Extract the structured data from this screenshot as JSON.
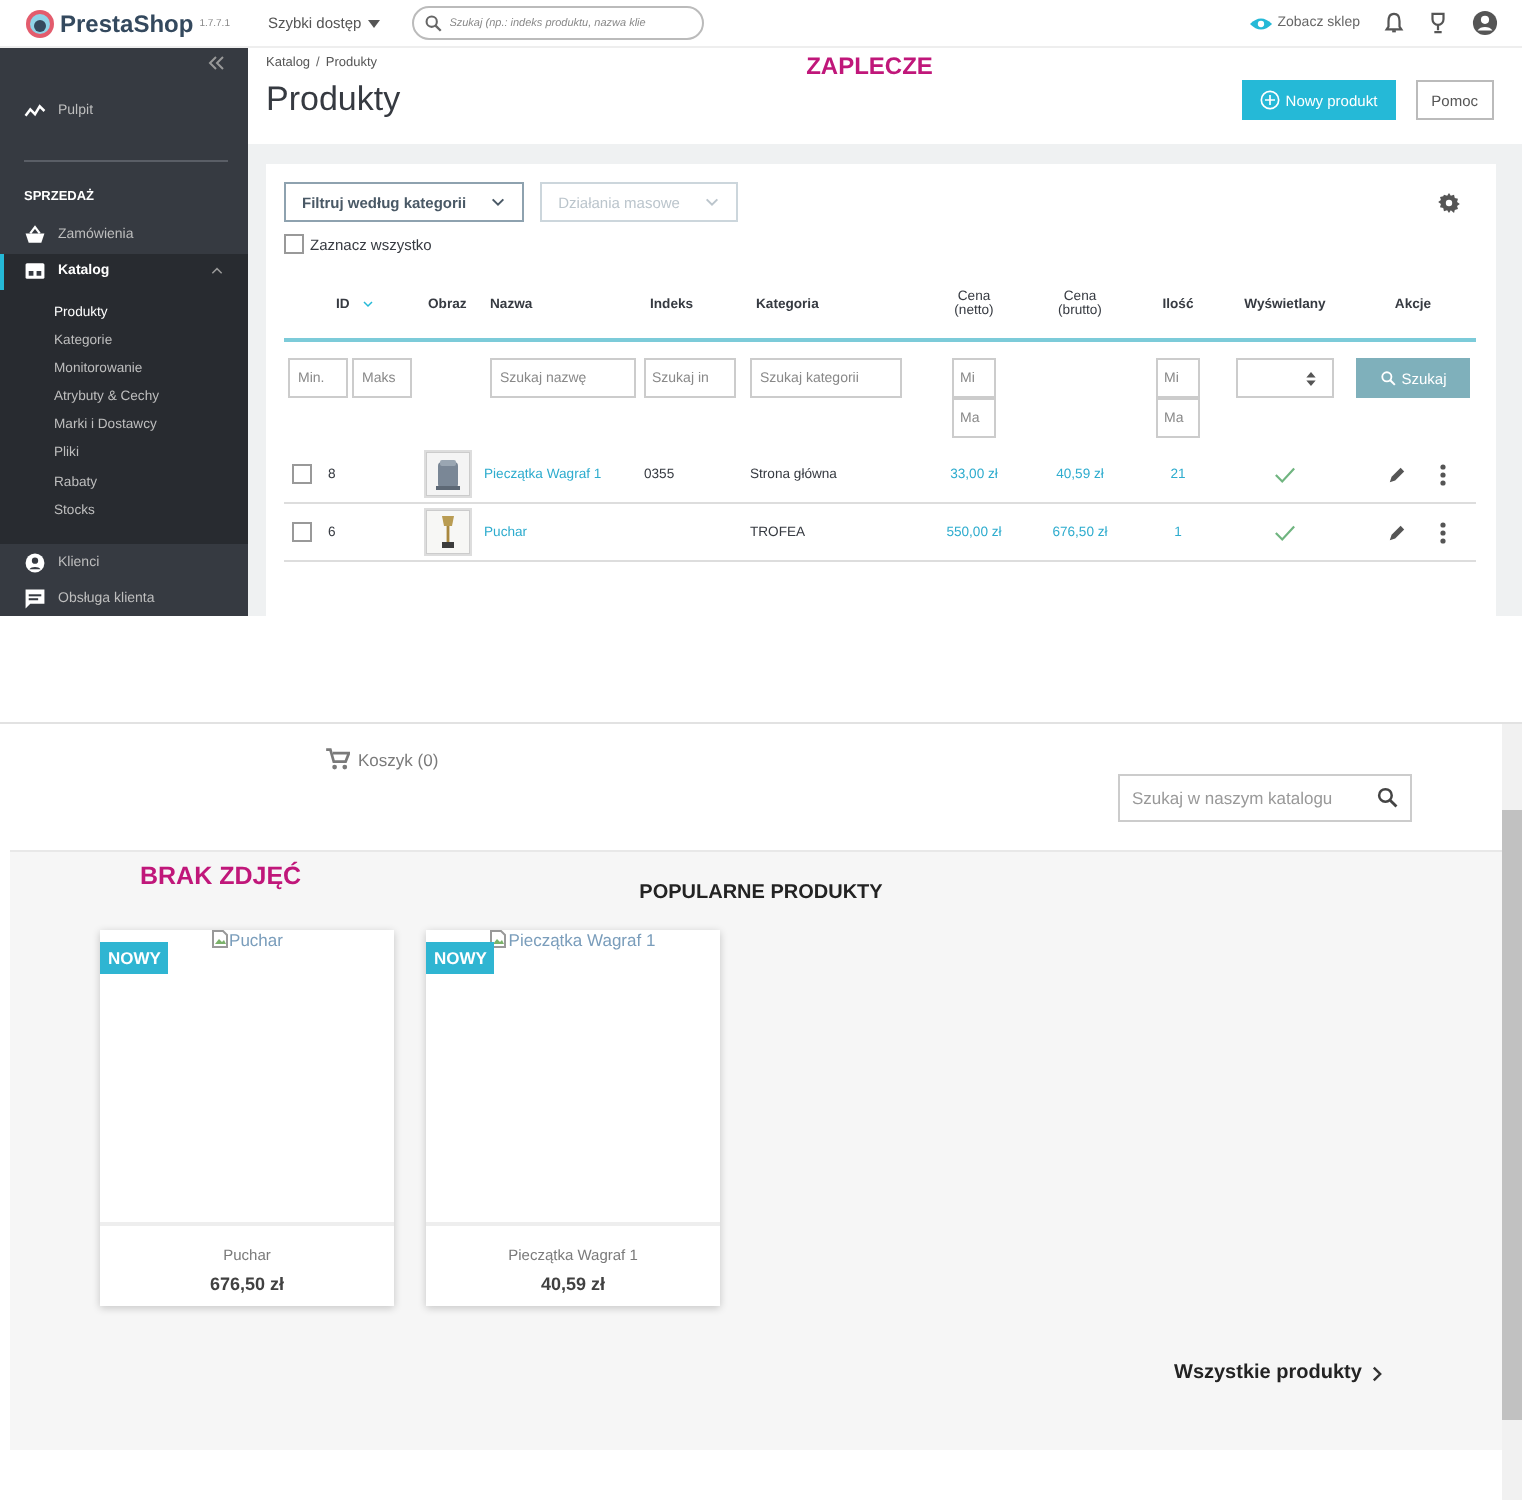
{
  "admin": {
    "logo": "PrestaShop",
    "version": "1.7.7.1",
    "quick_access": "Szybki dostęp",
    "search": {
      "placeholder": "Szukaj (np.: indeks produktu, nazwa klie"
    },
    "view_shop": "Zobacz sklep",
    "annotation": "ZAPLECZE",
    "sidebar": {
      "groups": [
        {
          "items": [
            {
              "label": "Pulpit",
              "selected": false
            }
          ]
        },
        {
          "heading": "SPRZEDAŻ",
          "items": [
            {
              "label": "Zamówienia",
              "selected": false
            },
            {
              "label": "Katalog",
              "selected": true,
              "expanded": true,
              "children": [
                {
                  "label": "Produkty",
                  "selected": true
                },
                {
                  "label": "Kategorie",
                  "selected": false
                },
                {
                  "label": "Monitorowanie",
                  "selected": false
                },
                {
                  "label": "Atrybuty & Cechy",
                  "selected": false
                },
                {
                  "label": "Marki i Dostawcy",
                  "selected": false
                },
                {
                  "label": "Pliki",
                  "selected": false
                },
                {
                  "label": "Rabaty",
                  "selected": false
                },
                {
                  "label": "Stocks",
                  "selected": false
                }
              ]
            },
            {
              "label": "Klienci",
              "selected": false
            },
            {
              "label": "Obsługa klienta",
              "selected": false
            }
          ]
        }
      ]
    },
    "breadcrumb": {
      "items": [
        "Katalog",
        "Produkty"
      ],
      "separator": "/"
    },
    "title": "Produkty",
    "buttons": [
      {
        "label": "Nowy produkt",
        "kind": "primary"
      },
      {
        "label": "Pomoc",
        "kind": "secondary"
      }
    ],
    "toolbar": {
      "category_filter": "Filtruj według kategorii",
      "bulk_actions": {
        "label": "Działania masowe",
        "disabled": true
      },
      "select_all": {
        "label": "Zaznacz wszystko",
        "checked": false
      }
    },
    "table": {
      "columns": [
        {
          "label": "ID",
          "sorted": true,
          "filter": {
            "kind": "pair",
            "placeholders": [
              "Min.",
              "Maks"
            ]
          }
        },
        {
          "label": "Obraz",
          "sorted": false,
          "filter": {
            "kind": "none"
          }
        },
        {
          "label": "Nazwa",
          "sorted": false,
          "filter": {
            "kind": "text",
            "placeholders": [
              "Szukaj nazwę"
            ]
          }
        },
        {
          "label": "Indeks",
          "sorted": false,
          "filter": {
            "kind": "text",
            "placeholders": [
              "Szukaj in"
            ]
          }
        },
        {
          "label": "Kategoria",
          "sorted": false,
          "filter": {
            "kind": "text",
            "placeholders": [
              "Szukaj kategorii"
            ]
          }
        },
        {
          "label": "Cena (netto)",
          "sorted": false,
          "filter": {
            "kind": "stack",
            "placeholders": [
              "Mi",
              "Ma"
            ]
          }
        },
        {
          "label": "Cena (brutto)",
          "sorted": false,
          "filter": {
            "kind": "none"
          }
        },
        {
          "label": "Ilość",
          "sorted": false,
          "filter": {
            "kind": "stack",
            "placeholders": [
              "Mi",
              "Ma"
            ]
          }
        },
        {
          "label": "Wyświetlany",
          "sorted": false,
          "filter": {
            "kind": "select"
          }
        },
        {
          "label": "Akcje",
          "sorted": false,
          "filter": {
            "kind": "button",
            "label": "Szukaj",
            "disabled": true
          }
        }
      ],
      "rows": [
        {
          "selected": false,
          "id": "8",
          "name": "Pieczątka Wagraf 1",
          "index": "0355",
          "category": "Strona główna",
          "price_net": "33,00 zł",
          "price_gross": "40,59 zł",
          "quantity": "21",
          "displayed": true
        },
        {
          "selected": false,
          "id": "6",
          "name": "Puchar",
          "category": "TROFEA",
          "price_net": "550,00 zł",
          "price_gross": "676,50 zł",
          "quantity": "1",
          "displayed": true
        }
      ]
    }
  },
  "store": {
    "cart": "Koszyk (0)",
    "search": {
      "placeholder": "Szukaj w naszym katalogu"
    },
    "annotation": "BRAK ZDJĘĆ",
    "heading": "POPULARNE PRODUKTY",
    "products": [
      {
        "badge": "NOWY",
        "image_alt": "Puchar",
        "name": "Puchar",
        "price": "676,50 zł"
      },
      {
        "badge": "NOWY",
        "image_alt": "Pieczątka Wagraf 1",
        "name": "Pieczątka Wagraf 1",
        "price": "40,59 zł"
      }
    ],
    "all_products": "Wszystkie produkty"
  }
}
